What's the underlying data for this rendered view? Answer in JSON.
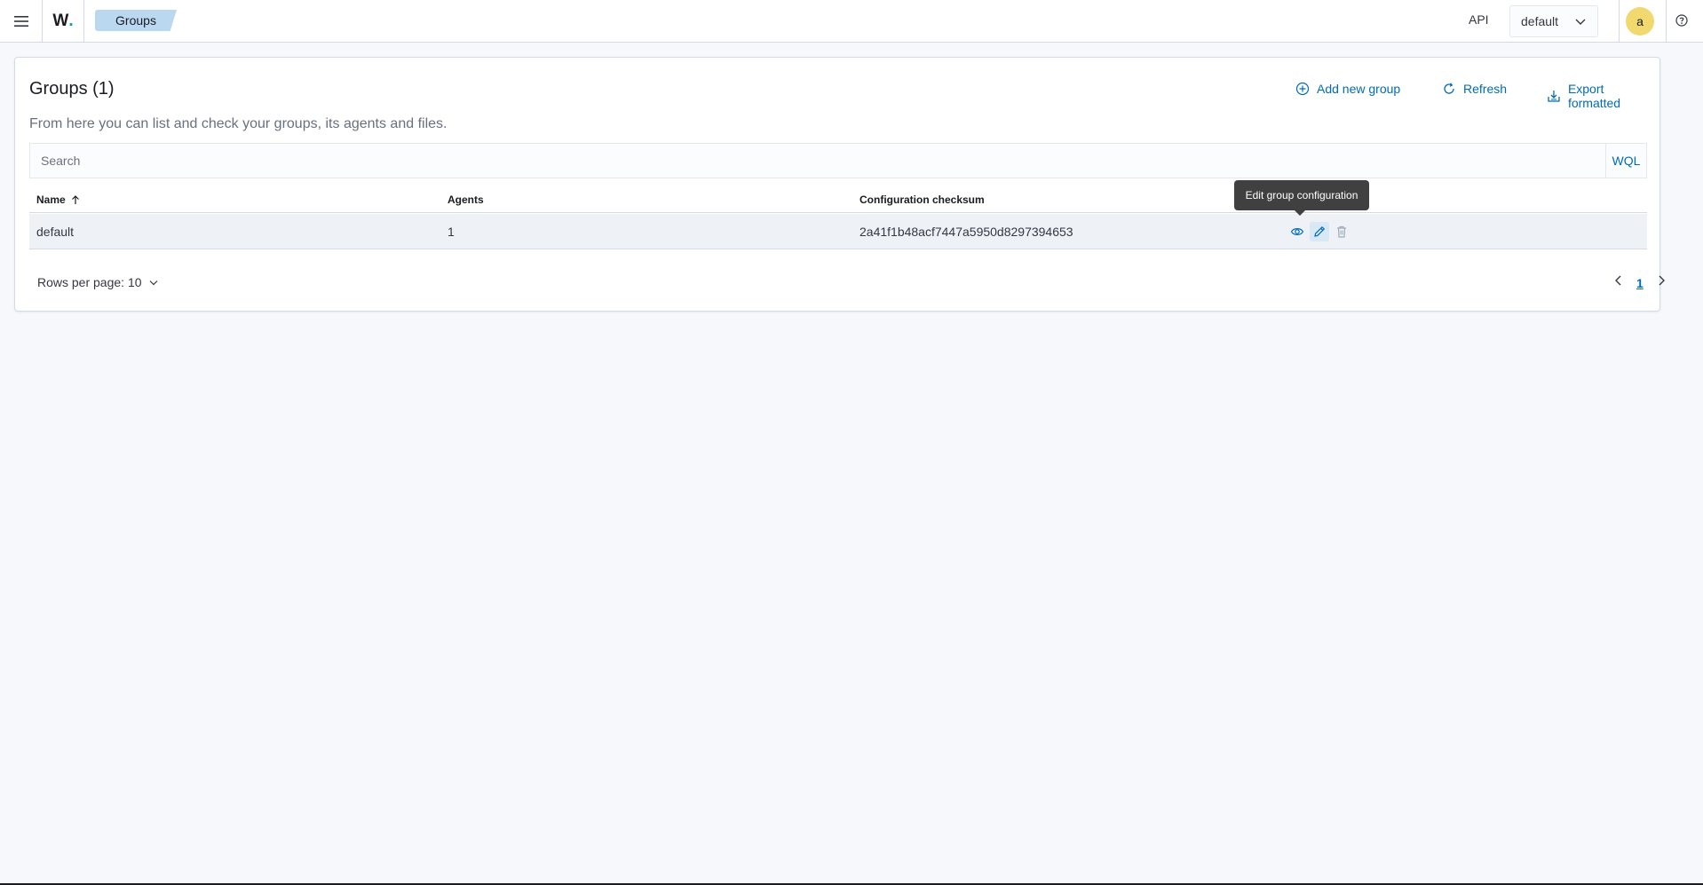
{
  "header": {
    "breadcrumb": "Groups",
    "logo_text": "W",
    "api_label": "API",
    "api_selected": "default",
    "avatar_initial": "a"
  },
  "main": {
    "title": "Groups (1)",
    "description": "From here you can list and check your groups, its agents and files.",
    "actions": {
      "add": "Add new group",
      "refresh": "Refresh",
      "export": "Export formatted"
    },
    "search": {
      "placeholder": "Search",
      "value": "",
      "wql_label": "WQL"
    },
    "table": {
      "columns": [
        "Name",
        "Agents",
        "Configuration checksum"
      ],
      "sort": {
        "column": "Name",
        "direction": "ascending"
      },
      "rows": [
        {
          "name": "default",
          "agents": "1",
          "checksum": "2a41f1b48acf7447a5950d8297394653"
        }
      ]
    },
    "tooltip": "Edit group configuration",
    "pagination": {
      "rows_per_page_label": "Rows per page: 10",
      "current_page": "1"
    }
  },
  "colors": {
    "accent": "#006bb8",
    "breadcrumb_bg": "#bad8f0",
    "avatar_bg": "#f1d86f",
    "row_highlight": "#eef2f7",
    "tooltip_bg": "#404040"
  },
  "icons": {
    "menu": "hamburger-icon",
    "add": "plus-circle-icon",
    "refresh": "refresh-icon",
    "export": "export-icon",
    "view": "eye-icon",
    "edit": "pencil-icon",
    "delete": "trash-icon",
    "help": "help-icon"
  }
}
